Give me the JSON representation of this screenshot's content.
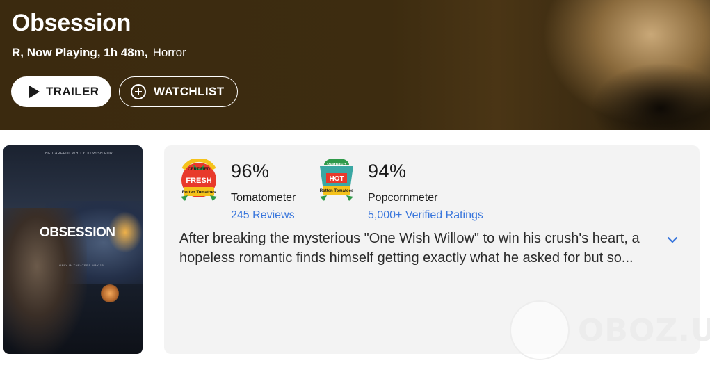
{
  "header": {
    "title": "Obsession",
    "meta_main": "R, Now Playing, 1h 48m,",
    "meta_genre": "Horror",
    "trailer_label": "TRAILER",
    "watchlist_label": "WATCHLIST"
  },
  "poster": {
    "tagline": "HE CAREFUL WHO YOU WISH FOR...",
    "title": "OBSESSION",
    "footer": "ONLY IN THEATERS MAY 15"
  },
  "scores": {
    "tomatometer": {
      "percent": "96%",
      "label": "Tomatometer",
      "reviews": "245 Reviews",
      "badge_top": "CERTIFIED",
      "badge_main": "FRESH",
      "badge_brand": "Rotten Tomatoes"
    },
    "popcornmeter": {
      "percent": "94%",
      "label": "Popcornmeter",
      "ratings": "5,000+ Verified Ratings",
      "badge_top": "VERIFIED",
      "badge_main": "HOT",
      "badge_brand": "Rotten Tomatoes"
    }
  },
  "synopsis": {
    "line1": "After breaking the mysterious \"One Wish Willow\" to win his crush's heart, a",
    "line2": "hopeless romantic finds himself getting exactly what he asked for but so..."
  },
  "watermark": {
    "text": "OBOZ.UA"
  },
  "colors": {
    "hero_bg": "#3d2c10",
    "link": "#3976dc",
    "card_bg": "#f3f3f3",
    "fresh_red": "#e8392b",
    "badge_green": "#2f9a4a",
    "hot_teal": "#3aa7a3"
  },
  "icons": {
    "trailer": "play-icon",
    "watchlist": "plus-circle-icon",
    "expand": "chevron-down-icon"
  }
}
